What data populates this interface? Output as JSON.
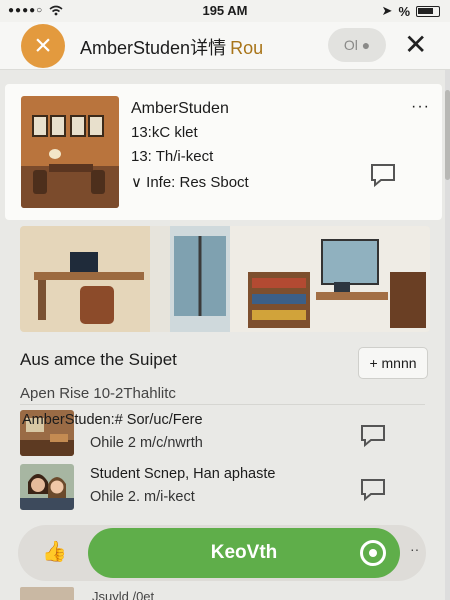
{
  "status": {
    "time": "195 AM",
    "right": "%"
  },
  "nav": {
    "title": "AmberStuden详情",
    "subtitle": "Rou",
    "pill": "Ol"
  },
  "card": {
    "name": "AmberStuden",
    "line1": "13:kC klet",
    "line2": "13: Th/i-kect",
    "line3": "Infe: Res Sboct",
    "more": "···"
  },
  "section": {
    "title": "Aus amce the Suipet",
    "button": "+ mnnn",
    "subtitle": "Apen Rise  10-2Thahlitc"
  },
  "list": [
    {
      "title": "AmberStuden:# Sor/uc/Fere",
      "sub": "Ohile  2 m/c/nwrth"
    },
    {
      "title": "Student Scnep, Han aphaste",
      "sub": "Ohile  2. m/i-kect"
    }
  ],
  "bottom": {
    "cta": "KeoVth",
    "more": "··"
  },
  "peek": {
    "text": "Jsuyld /0et"
  }
}
